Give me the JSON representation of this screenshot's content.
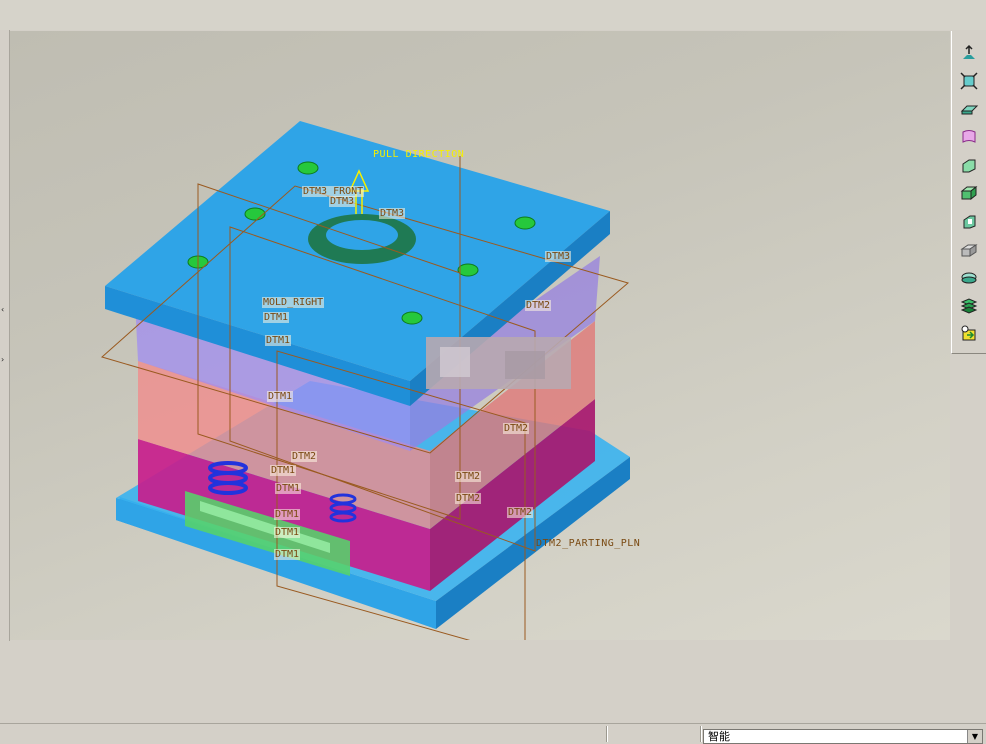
{
  "graphics_window": {
    "pull_direction_label": "PULL DIRECTION",
    "parting_plane_label": "DTM2_PARTING_PLN",
    "datum_labels": [
      "DTM3_FRONT",
      "DTM3",
      "DTM3",
      "DTM3",
      "MOLD_RIGHT",
      "DTM1",
      "DTM1",
      "DTM1",
      "DTM2",
      "DTM2",
      "DTM2",
      "DTM2",
      "DTM2",
      "DTM1",
      "DTM1",
      "DTM1",
      "DTM1",
      "DTM1",
      "DTM2"
    ]
  },
  "left_sash": {
    "collapse_glyph": "‹",
    "expand_glyph": "›"
  },
  "toolbar": {
    "tools": [
      "datum-display-icon",
      "fit-view-icon",
      "plane-icon",
      "surface-icon",
      "extrude-icon",
      "box-icon",
      "cut-icon",
      "mold-component-icon",
      "shell-icon",
      "layer-icon",
      "run-icon"
    ]
  },
  "status_bar": {
    "filter_value": "智能",
    "filter_arrow": "▼"
  },
  "colors": {
    "top_plate": "#2fa4e7",
    "cavity_plate": "#f08c8c",
    "core_plate": "#c81e8c",
    "ejector_plate": "#56d36a",
    "datum_line": "#9a5a20",
    "spring": "#2233dd",
    "leader_pin": "#26c83c"
  }
}
